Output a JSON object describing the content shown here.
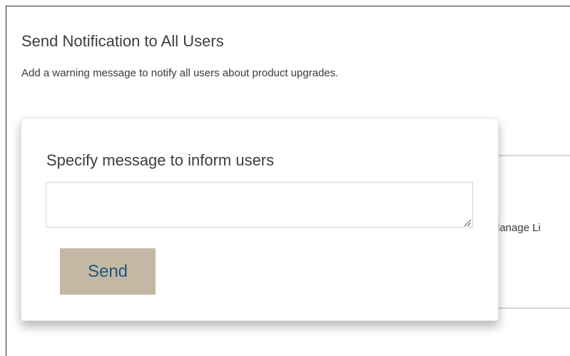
{
  "page": {
    "title": "Send Notification to All Users",
    "subtitle": "Add a warning message to notify all users about product upgrades."
  },
  "background_panel": {
    "partial_text": "lanage Li"
  },
  "popup": {
    "label": "Specify message to inform users",
    "message_value": "",
    "message_placeholder": "",
    "send_label": "Send"
  },
  "colors": {
    "send_button_bg": "#c3b8a3",
    "send_button_text": "#24567f"
  }
}
